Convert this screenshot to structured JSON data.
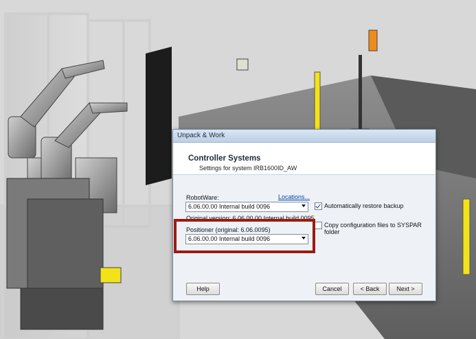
{
  "dialog": {
    "title": "Unpack & Work",
    "header_title": "Controller Systems",
    "header_subtitle": "Settings for system IRB1600ID_AW"
  },
  "robotware": {
    "label": "RobotWare:",
    "locations_link": "Locations...",
    "selected": "6.06.00.00 Internal build 0096",
    "original_version": "Original version: 6.06.00.00 Internal build 0095"
  },
  "positioner": {
    "label": "Positioner (original: 6.06.0095)",
    "selected": "6.06.00.00 Internal build 0096"
  },
  "options": {
    "restore_backup": {
      "label": "Automatically restore backup",
      "checked": true
    },
    "copy_config": {
      "label": "Copy configuration files to SYSPAR folder",
      "checked": false
    }
  },
  "buttons": {
    "help": "Help",
    "cancel": "Cancel",
    "back": "< Back",
    "next": "Next >"
  },
  "colors": {
    "highlight": "#9b1b12",
    "safety_yellow": "#f2e21a",
    "safety_orange": "#f08a1c"
  }
}
